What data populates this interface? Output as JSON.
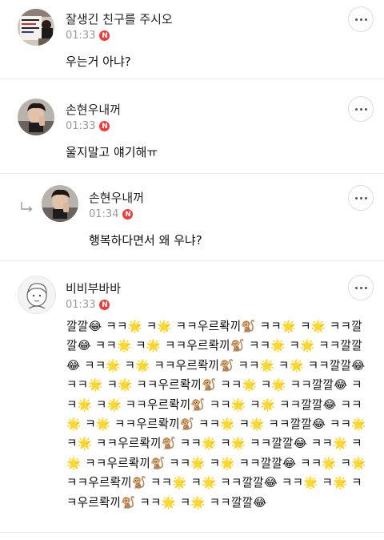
{
  "comments": [
    {
      "author": "잘생긴 친구를 주시오",
      "time": "01:33",
      "badge": "N",
      "text": "우는거 아냐?",
      "avatar_icon": "profile-photo-sign"
    },
    {
      "author": "손현우내꺼",
      "time": "01:33",
      "badge": "N",
      "text": "울지말고 얘기해ㅠ",
      "avatar_icon": "profile-photo-person"
    },
    {
      "author": "손현우내꺼",
      "time": "01:34",
      "badge": "N",
      "text": "행복하다면서 왜 우냐?",
      "is_reply": true,
      "avatar_icon": "profile-photo-person"
    },
    {
      "author": "비비부바바",
      "time": "01:33",
      "badge": "N",
      "text": "깔깔😂 ㅋㅋ🌟 ㅋ🌟 ㅋㅋ우르롹끼🐒 ㅋㅋ🌟 ㅋ🌟 ㅋㅋ깔깔😂 ㅋㅋ🌟 ㅋ🌟 ㅋㅋ우르롹끼🐒 ㅋㅋ🌟 ㅋ🌟 ㅋㅋ깔깔😂 ㅋㅋ🌟 ㅋ🌟 ㅋㅋ우르롹끼🐒 ㅋㅋ🌟 ㅋ🌟 ㅋㅋ깔깔😂 ㅋㅋ🌟 ㅋ🌟 ㅋㅋ우르롹끼🐒 ㅋㅋ🌟 ㅋ🌟 ㅋㅋ깔깔😂 ㅋㅋ🌟 ㅋ🌟 ㅋㅋ우르롹끼🐒 ㅋㅋ🌟 ㅋ🌟 ㅋㅋ깔깔😂 ㅋㅋ🌟 ㅋ🌟 ㅋㅋ우르롹끼🐒 ㅋㅋ🌟 ㅋ🌟 ㅋㅋ깔깔😂 ㅋㅋ🌟 ㅋ🌟 ㅋㅋ우르롹끼🐒 ㅋㅋ🌟 ㅋ🌟 ㅋㅋ깔깔😂 ㅋㅋ🌟 ㅋ🌟 ㅋㅋ우르롹끼🐒 ㅋㅋ🌟 ㅋ🌟 ㅋㅋ깔깔😂 ㅋㅋ🌟 ㅋ🌟 ㅋㅋ우르롹끼🐒 ㅋㅋ🌟 ㅋ🌟 ㅋㅋ깔깔😂 ㅋㅋ🌟 ㅋ🌟 ㅋㅋ우르롹끼🐒 ㅋㅋ🌟 ㅋ🌟 ㅋㅋ깔깔😂",
      "avatar_icon": "default-avatar-drawing"
    }
  ],
  "colors": {
    "badge": "#ee3b3b",
    "time": "#9a9a9a",
    "divider": "#ececec"
  }
}
